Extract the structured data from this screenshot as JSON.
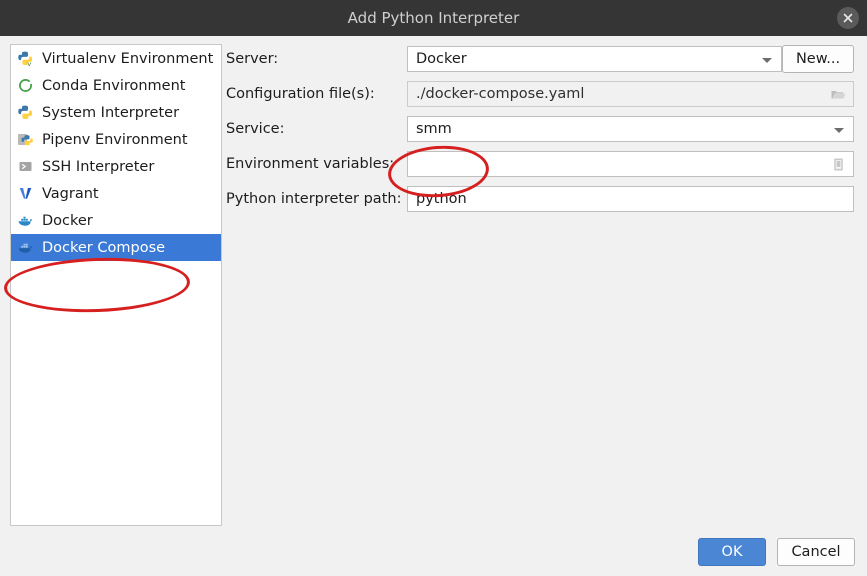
{
  "window": {
    "title": "Add Python Interpreter",
    "close_icon": "close-icon"
  },
  "sidebar": {
    "items": [
      {
        "label": "Virtualenv Environment",
        "icon": "virtualenv-python-icon",
        "selected": false
      },
      {
        "label": "Conda Environment",
        "icon": "conda-ring-icon",
        "selected": false
      },
      {
        "label": "System Interpreter",
        "icon": "python-icon",
        "selected": false
      },
      {
        "label": "Pipenv Environment",
        "icon": "pipenv-icon",
        "selected": false
      },
      {
        "label": "SSH Interpreter",
        "icon": "ssh-terminal-icon",
        "selected": false
      },
      {
        "label": "Vagrant",
        "icon": "vagrant-v-icon",
        "selected": false
      },
      {
        "label": "Docker",
        "icon": "docker-whale-icon",
        "selected": false
      },
      {
        "label": "Docker Compose",
        "icon": "docker-compose-icon",
        "selected": true
      }
    ]
  },
  "form": {
    "server": {
      "label": "Server:",
      "value": "Docker",
      "new_button": "New..."
    },
    "config_files": {
      "label": "Configuration file(s):",
      "value": "./docker-compose.yaml",
      "browse_icon": "folder-icon"
    },
    "service": {
      "label": "Service:",
      "value": "smm"
    },
    "env_vars": {
      "label": "Environment variables:",
      "value": "",
      "edit_icon": "list-edit-icon"
    },
    "interpreter_path": {
      "label": "Python interpreter path:",
      "value": "python"
    }
  },
  "footer": {
    "ok": "OK",
    "cancel": "Cancel"
  },
  "annotations": {
    "accent_color": "#d61f1f",
    "marks": [
      {
        "name": "sidebar-docker-compose-highlight"
      },
      {
        "name": "service-field-highlight"
      }
    ]
  },
  "colors": {
    "titlebar": "#353535",
    "dialog_background": "#f1f1f1",
    "selection_blue": "#3a79d6",
    "ok_button": "#4a86d3",
    "annotation_red": "#d61f1f"
  }
}
